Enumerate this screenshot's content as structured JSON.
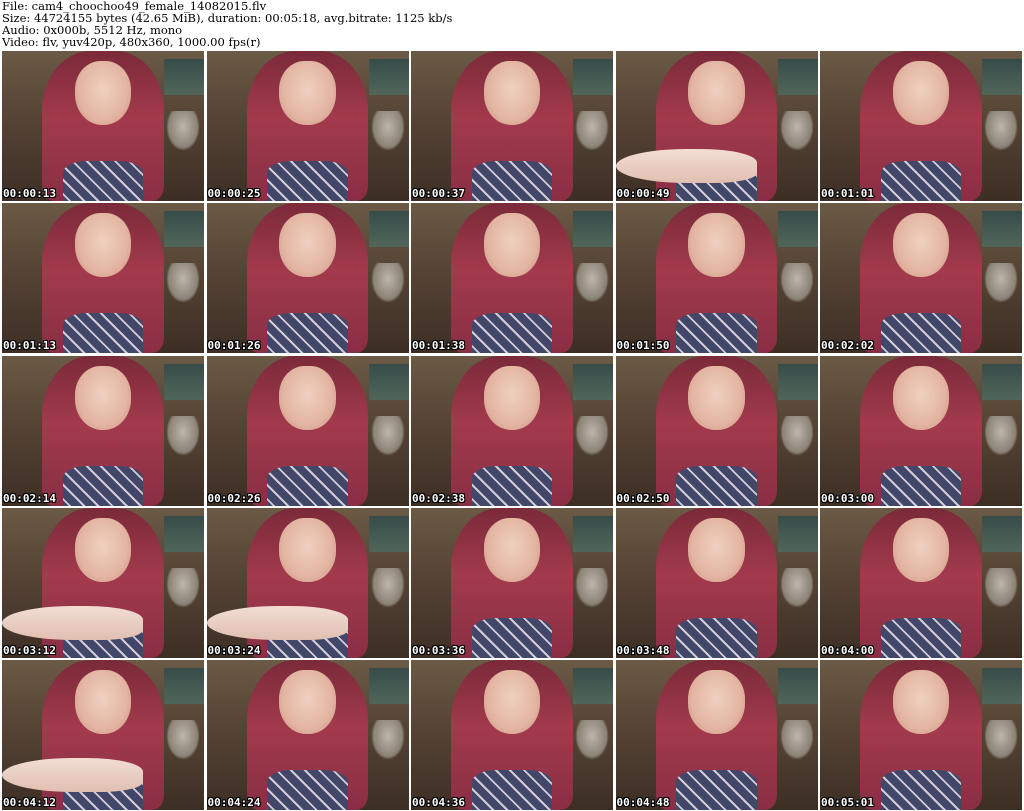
{
  "header": {
    "file_line": "File: cam4_choochoo49_female_14082015.flv",
    "size_line": "Size: 44724155 bytes (42.65 MiB), duration: 00:05:18, avg.bitrate: 1125 kb/s",
    "audio_line": "Audio: 0x000b, 5512 Hz, mono",
    "video_line": "Video: flv, yuv420p, 480x360, 1000.00 fps(r)"
  },
  "thumbnails": [
    {
      "timestamp": "00:00:13",
      "hand": false
    },
    {
      "timestamp": "00:00:25",
      "hand": false
    },
    {
      "timestamp": "00:00:37",
      "hand": false
    },
    {
      "timestamp": "00:00:49",
      "hand": true
    },
    {
      "timestamp": "00:01:01",
      "hand": false
    },
    {
      "timestamp": "00:01:13",
      "hand": false
    },
    {
      "timestamp": "00:01:26",
      "hand": false
    },
    {
      "timestamp": "00:01:38",
      "hand": false
    },
    {
      "timestamp": "00:01:50",
      "hand": false
    },
    {
      "timestamp": "00:02:02",
      "hand": false
    },
    {
      "timestamp": "00:02:14",
      "hand": false
    },
    {
      "timestamp": "00:02:26",
      "hand": false
    },
    {
      "timestamp": "00:02:38",
      "hand": false
    },
    {
      "timestamp": "00:02:50",
      "hand": false
    },
    {
      "timestamp": "00:03:00",
      "hand": false
    },
    {
      "timestamp": "00:03:12",
      "hand": true
    },
    {
      "timestamp": "00:03:24",
      "hand": true
    },
    {
      "timestamp": "00:03:36",
      "hand": false
    },
    {
      "timestamp": "00:03:48",
      "hand": false
    },
    {
      "timestamp": "00:04:00",
      "hand": false
    },
    {
      "timestamp": "00:04:12",
      "hand": true
    },
    {
      "timestamp": "00:04:24",
      "hand": false
    },
    {
      "timestamp": "00:04:36",
      "hand": false
    },
    {
      "timestamp": "00:04:48",
      "hand": false
    },
    {
      "timestamp": "00:05:01",
      "hand": false
    }
  ]
}
